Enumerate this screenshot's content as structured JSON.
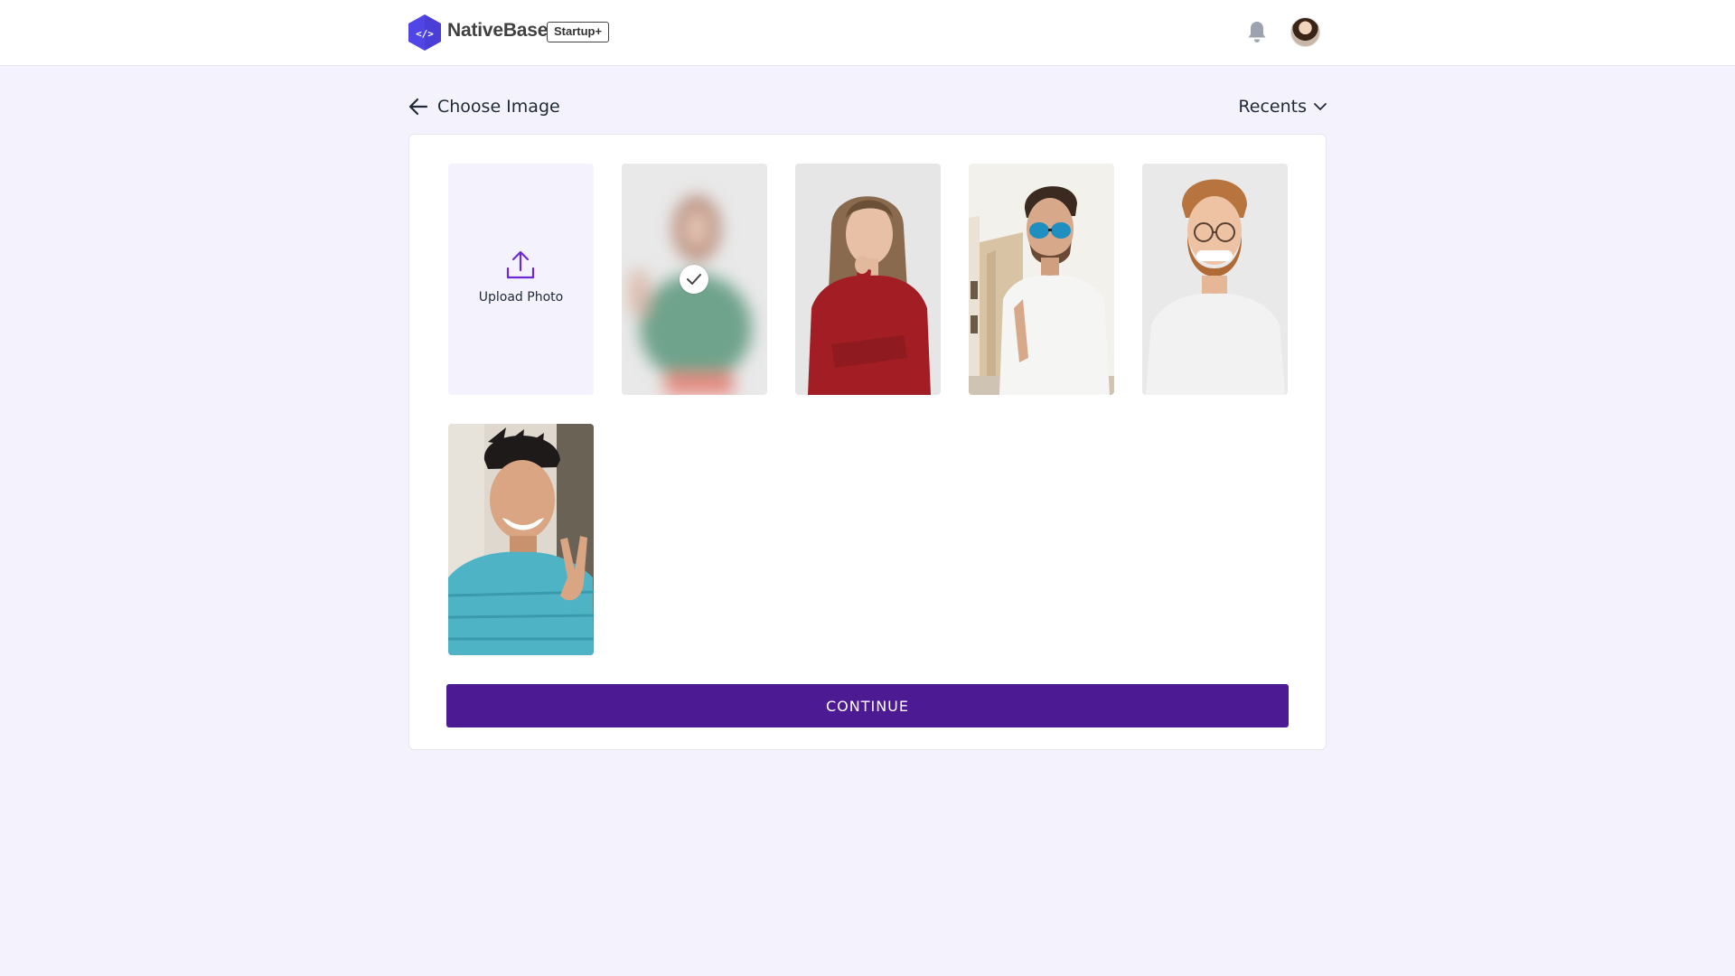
{
  "header": {
    "brand_name": "NativeBase",
    "brand_badge": "Startup+",
    "logo_glyph": "</>",
    "notification_icon": "bell-icon",
    "avatar_icon": "user-avatar"
  },
  "page": {
    "title": "Choose Image",
    "back_icon": "arrow-left-icon",
    "filter_label": "Recents",
    "filter_icon": "chevron-down-icon"
  },
  "gallery": {
    "upload_label": "Upload Photo",
    "upload_icon": "upload-icon",
    "selected_index": 0,
    "photos": [
      {
        "name": "woman-green-sweater",
        "selected": true
      },
      {
        "name": "woman-red-sweater",
        "selected": false
      },
      {
        "name": "man-sunglasses",
        "selected": false
      },
      {
        "name": "man-red-beard",
        "selected": false
      },
      {
        "name": "man-blue-sweater-peace-sign",
        "selected": false
      }
    ]
  },
  "actions": {
    "continue_label": "CONTINUE"
  },
  "colors": {
    "primary": "#4c1b94",
    "background": "#f4f2fd",
    "logo": "#5046e5",
    "icon_gray": "#9ca3af"
  }
}
